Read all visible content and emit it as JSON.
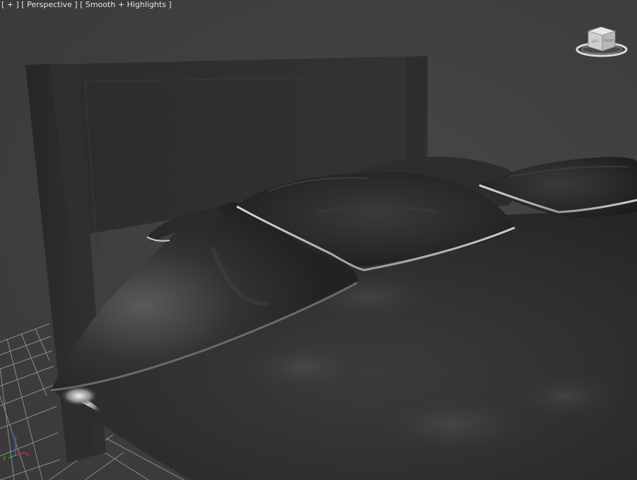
{
  "viewport": {
    "label_plus": "[ + ]",
    "label_view": "[ Perspective ]",
    "label_shading": "[ Smooth + Highlights ]",
    "background_color": "#444444"
  },
  "viewcube": {
    "face_left": "LEFT",
    "face_front": "FRONT"
  },
  "axis": {
    "x_label": "x",
    "y_label": "y",
    "z_label": "z",
    "x_color": "#e03030",
    "y_color": "#30c030",
    "z_color": "#3a6fe0"
  }
}
